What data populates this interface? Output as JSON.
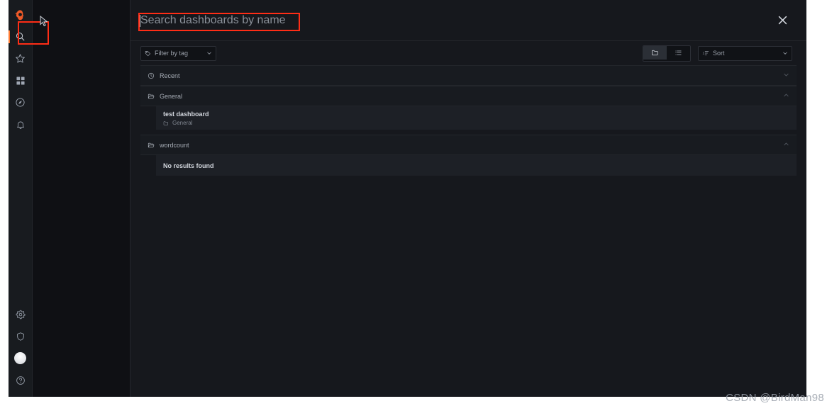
{
  "sidebar": {
    "logo": {
      "name": "grafana-logo",
      "color": "#f05a28"
    },
    "top_items": [
      {
        "id": "search",
        "label": "Search",
        "icon": "search-icon",
        "active": true
      },
      {
        "id": "starred",
        "label": "Starred",
        "icon": "star-icon",
        "active": false
      },
      {
        "id": "dashboards",
        "label": "Dashboards",
        "icon": "apps-grid-icon",
        "active": false
      },
      {
        "id": "explore",
        "label": "Explore",
        "icon": "compass-icon",
        "active": false
      },
      {
        "id": "alerting",
        "label": "Alerting",
        "icon": "bell-icon",
        "active": false
      }
    ],
    "bottom_items": [
      {
        "id": "configuration",
        "label": "Configuration",
        "icon": "gear-icon"
      },
      {
        "id": "server-admin",
        "label": "Server Admin",
        "icon": "shield-icon"
      },
      {
        "id": "profile",
        "label": "Profile",
        "icon": "user-avatar"
      },
      {
        "id": "help",
        "label": "Help",
        "icon": "question-circle-icon"
      }
    ]
  },
  "search": {
    "placeholder": "Search dashboards by name",
    "value": "",
    "close_label": "✕"
  },
  "toolbar": {
    "tag_filter": {
      "label": "Filter by tag",
      "icon": "tag-icon",
      "chevron": "chevron-down-icon"
    },
    "view_folder": {
      "label": "",
      "icon": "folder-icon",
      "active": true
    },
    "view_list": {
      "label": "",
      "icon": "list-icon",
      "active": false
    },
    "sort": {
      "label": "Sort",
      "icon": "sort-amount-icon",
      "chevron": "chevron-down-icon"
    }
  },
  "sections": [
    {
      "id": "recent",
      "title": "Recent",
      "icon": "clock-icon",
      "expanded": false,
      "chevron": "chevron-down-icon",
      "items": []
    },
    {
      "id": "general",
      "title": "General",
      "icon": "folder-open-icon",
      "expanded": true,
      "chevron": "chevron-up-icon",
      "items": [
        {
          "title": "test dashboard",
          "folder": "General",
          "folder_icon": "folder-icon"
        }
      ]
    },
    {
      "id": "wordcount",
      "title": "wordcount",
      "icon": "folder-open-icon",
      "expanded": true,
      "chevron": "chevron-up-icon",
      "empty_message": "No results found",
      "items": []
    }
  ],
  "watermark": "CSDN @BirdMan98",
  "colors": {
    "app_bg": "#0f1014",
    "sidebar_bg": "#181b1f",
    "panel_bg": "#16181d",
    "row_bg": "#1d2026",
    "accent": "#f05a28",
    "highlight": "#ff2d16",
    "text_primary": "#d2d6dd",
    "text_muted": "#9aa0aa"
  }
}
